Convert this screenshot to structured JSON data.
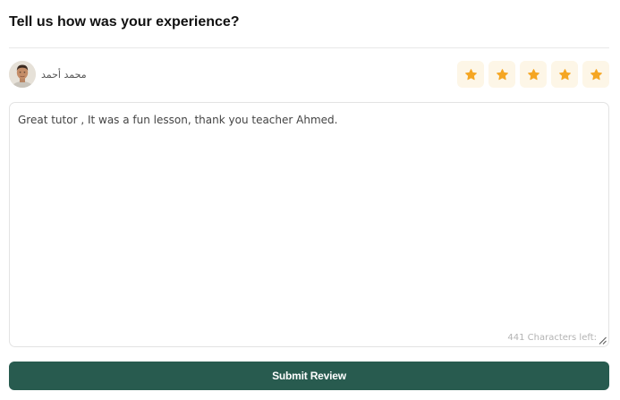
{
  "header": {
    "title": "Tell us how was your experience?"
  },
  "reviewer": {
    "name": "محمد أحمد",
    "avatar_icon": "user-avatar-photo"
  },
  "rating": {
    "value": 5,
    "max": 5,
    "star_color": "#f5a623",
    "star_bg": "#fdf6e7",
    "icon": "star-icon"
  },
  "review": {
    "text": "Great tutor , It was a fun lesson, thank you teacher Ahmed.",
    "characters_left": "441 Characters left:"
  },
  "actions": {
    "submit_label": "Submit Review",
    "submit_color": "#285b4f"
  }
}
